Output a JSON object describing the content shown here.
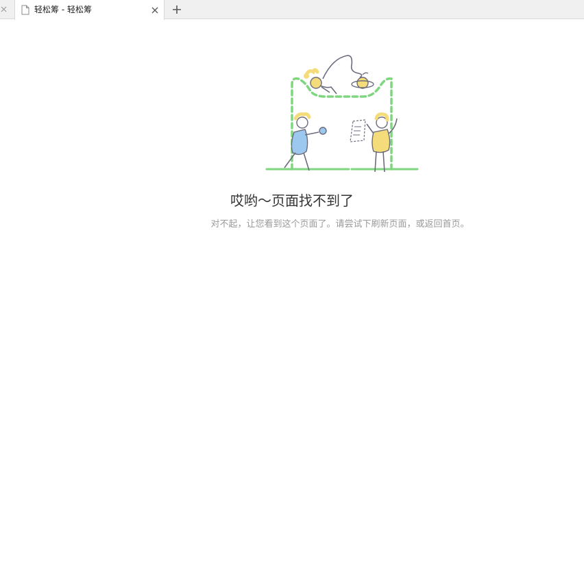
{
  "browser": {
    "tab": {
      "title": "轻松筹 - 轻松筹",
      "icon": "document-icon",
      "close_icon": "close-icon"
    },
    "prev_tab_close_icon": "close-icon",
    "new_tab_icon": "plus-icon"
  },
  "error_page": {
    "title": "哎哟～页面找不到了",
    "description": "对不起，让您看到这个页面了。请尝试下刷新页面，或返回首页。",
    "colors": {
      "accent_green": "#7ed67e",
      "figure_blue": "#9cc8f0",
      "figure_yellow": "#f5dc7a",
      "line_gray": "#6b6b7b"
    }
  }
}
